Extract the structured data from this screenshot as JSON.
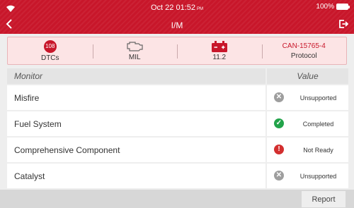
{
  "colors": {
    "accent": "#c8162a",
    "ok": "#22a34a",
    "neutral": "#9e9e9e",
    "error": "#d32f2f"
  },
  "status_bar": {
    "time": "Oct 22 01:52",
    "ampm": "PM",
    "battery": "100%"
  },
  "header": {
    "title": "I/M"
  },
  "info": {
    "dtc_count": "108",
    "dtc_label": "DTCs",
    "mil_label": "MIL",
    "voltage": "11.2",
    "protocol_name": "CAN-15765-4",
    "protocol_label": "Protocol"
  },
  "table": {
    "col_monitor": "Monitor",
    "col_value": "Value",
    "rows": [
      {
        "monitor": "Misfire",
        "status_icon": "unsupported-icon",
        "value": "Unsupported"
      },
      {
        "monitor": "Fuel System",
        "status_icon": "check-icon",
        "value": "Completed"
      },
      {
        "monitor": "Comprehensive Component",
        "status_icon": "warning-icon",
        "value": "Not Ready"
      },
      {
        "monitor": "Catalyst",
        "status_icon": "unsupported-icon",
        "value": "Unsupported"
      }
    ]
  },
  "footer": {
    "report_label": "Report"
  }
}
